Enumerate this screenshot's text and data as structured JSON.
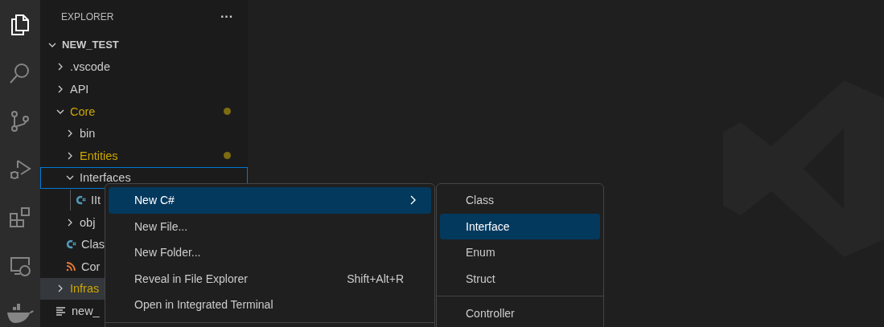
{
  "activity_bar": [
    {
      "kind": "explorer",
      "selected": true
    },
    {
      "kind": "search",
      "selected": false
    },
    {
      "kind": "source-control",
      "selected": false
    },
    {
      "kind": "run-debug",
      "selected": false
    },
    {
      "kind": "extensions",
      "selected": false
    },
    {
      "kind": "remote",
      "selected": false
    },
    {
      "kind": "docker",
      "selected": false
    }
  ],
  "sidebar": {
    "title": "EXPLORER",
    "more": "···",
    "root": {
      "label": "NEW_TEST",
      "expanded": true,
      "children": [
        {
          "label": ".vscode",
          "kind": "folder",
          "expanded": false,
          "modified": false,
          "selected": false,
          "hovered": false
        },
        {
          "label": "API",
          "kind": "folder",
          "expanded": false,
          "modified": false,
          "selected": false,
          "hovered": false
        },
        {
          "label": "Core",
          "kind": "folder",
          "expanded": true,
          "modified": true,
          "dot": true,
          "selected": false,
          "hovered": false,
          "children": [
            {
              "label": "bin",
              "kind": "folder",
              "expanded": false,
              "modified": false,
              "selected": false,
              "hovered": false
            },
            {
              "label": "Entities",
              "kind": "folder",
              "expanded": false,
              "modified": true,
              "dot": true,
              "selected": false,
              "hovered": false
            },
            {
              "label": "Interfaces",
              "kind": "folder",
              "expanded": true,
              "modified": false,
              "selected": true,
              "hovered": false,
              "children": [
                {
                  "label": "IIt",
                  "kind": "csharp",
                  "modified": false,
                  "selected": false,
                  "hovered": false
                }
              ]
            },
            {
              "label": "obj",
              "kind": "folder",
              "expanded": false,
              "modified": false,
              "selected": false,
              "hovered": false
            },
            {
              "label": "Clas",
              "kind": "csharp",
              "modified": false,
              "selected": false,
              "hovered": false
            },
            {
              "label": "Cor",
              "kind": "rss",
              "modified": false,
              "selected": false,
              "hovered": false
            }
          ]
        },
        {
          "label": "Infras",
          "kind": "folder",
          "expanded": false,
          "modified": true,
          "selected": false,
          "hovered": true
        },
        {
          "label": "new_",
          "kind": "text",
          "modified": false,
          "selected": false,
          "hovered": false
        }
      ]
    }
  },
  "context_menu": {
    "items": [
      {
        "kind": "item",
        "label": "New C#",
        "submenu": true,
        "selected": true
      },
      {
        "kind": "item",
        "label": "New File...",
        "submenu": false,
        "selected": false
      },
      {
        "kind": "item",
        "label": "New Folder...",
        "submenu": false,
        "selected": false
      },
      {
        "kind": "item",
        "label": "Reveal in File Explorer",
        "shortcut": "Shift+Alt+R",
        "submenu": false,
        "selected": false
      },
      {
        "kind": "item",
        "label": "Open in Integrated Terminal",
        "submenu": false,
        "selected": false
      },
      {
        "kind": "separator"
      }
    ],
    "submenu": [
      {
        "kind": "item",
        "label": "Class",
        "selected": false
      },
      {
        "kind": "item",
        "label": "Interface",
        "selected": true
      },
      {
        "kind": "item",
        "label": "Enum",
        "selected": false
      },
      {
        "kind": "item",
        "label": "Struct",
        "selected": false
      },
      {
        "kind": "separator"
      },
      {
        "kind": "item",
        "label": "Controller",
        "selected": false
      }
    ]
  }
}
